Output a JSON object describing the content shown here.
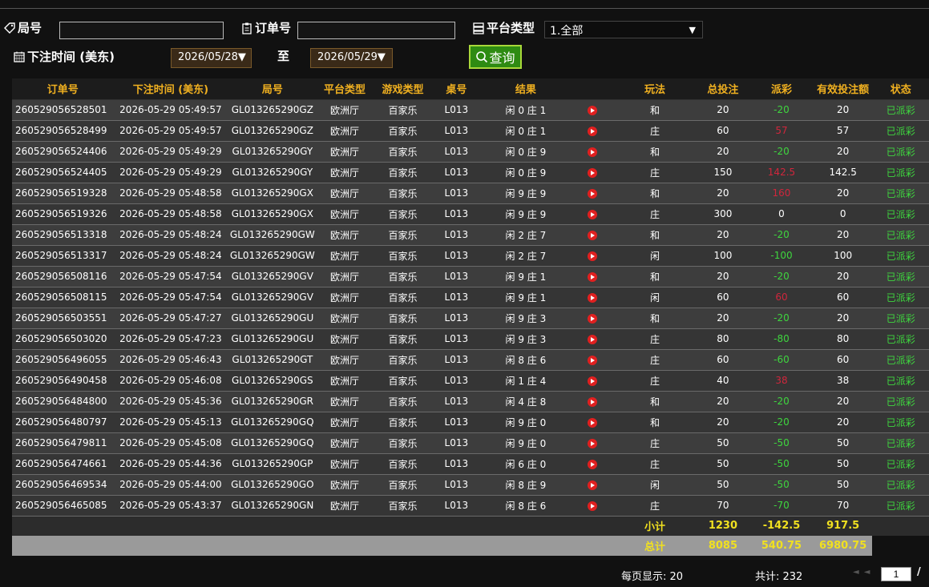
{
  "filters": {
    "round_label": "局号",
    "order_label": "订单号",
    "platform_label": "平台类型",
    "platform_value": "1.全部",
    "time_label": "下注时间 (美东)",
    "date_from": "2026/05/28▼",
    "to_label": "至",
    "date_to": "2026/05/29▼",
    "query_label": "查询"
  },
  "table": {
    "headers": [
      "订单号",
      "下注时间 (美东)",
      "局号",
      "平台类型",
      "游戏类型",
      "桌号",
      "结果",
      "",
      "玩法",
      "总投注",
      "派彩",
      "有效投注额",
      "状态"
    ],
    "rows": [
      [
        "260529056528501",
        "2026-05-29 05:49:57",
        "GL013265290GZ",
        "欧洲厅",
        "百家乐",
        "L013",
        "闲 0 庄 1",
        "和",
        "20",
        "-20",
        "20",
        "已派彩"
      ],
      [
        "260529056528499",
        "2026-05-29 05:49:57",
        "GL013265290GZ",
        "欧洲厅",
        "百家乐",
        "L013",
        "闲 0 庄 1",
        "庄",
        "60",
        "57",
        "57",
        "已派彩"
      ],
      [
        "260529056524406",
        "2026-05-29 05:49:29",
        "GL013265290GY",
        "欧洲厅",
        "百家乐",
        "L013",
        "闲 0 庄 9",
        "和",
        "20",
        "-20",
        "20",
        "已派彩"
      ],
      [
        "260529056524405",
        "2026-05-29 05:49:29",
        "GL013265290GY",
        "欧洲厅",
        "百家乐",
        "L013",
        "闲 0 庄 9",
        "庄",
        "150",
        "142.5",
        "142.5",
        "已派彩"
      ],
      [
        "260529056519328",
        "2026-05-29 05:48:58",
        "GL013265290GX",
        "欧洲厅",
        "百家乐",
        "L013",
        "闲 9 庄 9",
        "和",
        "20",
        "160",
        "20",
        "已派彩"
      ],
      [
        "260529056519326",
        "2026-05-29 05:48:58",
        "GL013265290GX",
        "欧洲厅",
        "百家乐",
        "L013",
        "闲 9 庄 9",
        "庄",
        "300",
        "0",
        "0",
        "已派彩"
      ],
      [
        "260529056513318",
        "2026-05-29 05:48:24",
        "GL013265290GW",
        "欧洲厅",
        "百家乐",
        "L013",
        "闲 2 庄 7",
        "和",
        "20",
        "-20",
        "20",
        "已派彩"
      ],
      [
        "260529056513317",
        "2026-05-29 05:48:24",
        "GL013265290GW",
        "欧洲厅",
        "百家乐",
        "L013",
        "闲 2 庄 7",
        "闲",
        "100",
        "-100",
        "100",
        "已派彩"
      ],
      [
        "260529056508116",
        "2026-05-29 05:47:54",
        "GL013265290GV",
        "欧洲厅",
        "百家乐",
        "L013",
        "闲 9 庄 1",
        "和",
        "20",
        "-20",
        "20",
        "已派彩"
      ],
      [
        "260529056508115",
        "2026-05-29 05:47:54",
        "GL013265290GV",
        "欧洲厅",
        "百家乐",
        "L013",
        "闲 9 庄 1",
        "闲",
        "60",
        "60",
        "60",
        "已派彩"
      ],
      [
        "260529056503551",
        "2026-05-29 05:47:27",
        "GL013265290GU",
        "欧洲厅",
        "百家乐",
        "L013",
        "闲 9 庄 3",
        "和",
        "20",
        "-20",
        "20",
        "已派彩"
      ],
      [
        "260529056503020",
        "2026-05-29 05:47:23",
        "GL013265290GU",
        "欧洲厅",
        "百家乐",
        "L013",
        "闲 9 庄 3",
        "庄",
        "80",
        "-80",
        "80",
        "已派彩"
      ],
      [
        "260529056496055",
        "2026-05-29 05:46:43",
        "GL013265290GT",
        "欧洲厅",
        "百家乐",
        "L013",
        "闲 8 庄 6",
        "庄",
        "60",
        "-60",
        "60",
        "已派彩"
      ],
      [
        "260529056490458",
        "2026-05-29 05:46:08",
        "GL013265290GS",
        "欧洲厅",
        "百家乐",
        "L013",
        "闲 1 庄 4",
        "庄",
        "40",
        "38",
        "38",
        "已派彩"
      ],
      [
        "260529056484800",
        "2026-05-29 05:45:36",
        "GL013265290GR",
        "欧洲厅",
        "百家乐",
        "L013",
        "闲 4 庄 8",
        "和",
        "20",
        "-20",
        "20",
        "已派彩"
      ],
      [
        "260529056480797",
        "2026-05-29 05:45:13",
        "GL013265290GQ",
        "欧洲厅",
        "百家乐",
        "L013",
        "闲 9 庄 0",
        "和",
        "20",
        "-20",
        "20",
        "已派彩"
      ],
      [
        "260529056479811",
        "2026-05-29 05:45:08",
        "GL013265290GQ",
        "欧洲厅",
        "百家乐",
        "L013",
        "闲 9 庄 0",
        "庄",
        "50",
        "-50",
        "50",
        "已派彩"
      ],
      [
        "260529056474661",
        "2026-05-29 05:44:36",
        "GL013265290GP",
        "欧洲厅",
        "百家乐",
        "L013",
        "闲 6 庄 0",
        "庄",
        "50",
        "-50",
        "50",
        "已派彩"
      ],
      [
        "260529056469534",
        "2026-05-29 05:44:00",
        "GL013265290GO",
        "欧洲厅",
        "百家乐",
        "L013",
        "闲 8 庄 9",
        "闲",
        "50",
        "-50",
        "50",
        "已派彩"
      ],
      [
        "260529056465085",
        "2026-05-29 05:43:37",
        "GL013265290GN",
        "欧洲厅",
        "百家乐",
        "L013",
        "闲 8 庄 6",
        "庄",
        "70",
        "-70",
        "70",
        "已派彩"
      ]
    ],
    "subtotal": {
      "label": "小计",
      "bet": "1230",
      "payout": "-142.5",
      "valid": "917.5"
    },
    "total": {
      "label": "总计",
      "bet": "8085",
      "payout": "540.75",
      "valid": "6980.75"
    }
  },
  "footer": {
    "per_page": "每页显示: 20",
    "total_count": "共计: 232",
    "page": "1",
    "page_sep": "/"
  },
  "colors": {
    "header_text": "#f0b020",
    "win": "#3ed63e",
    "loss_red": "#d0263c",
    "sum_text": "#f0e020"
  },
  "icons": [
    "tag-icon",
    "clipboard-icon",
    "server-icon",
    "calendar-icon",
    "search-icon",
    "play-icon"
  ]
}
